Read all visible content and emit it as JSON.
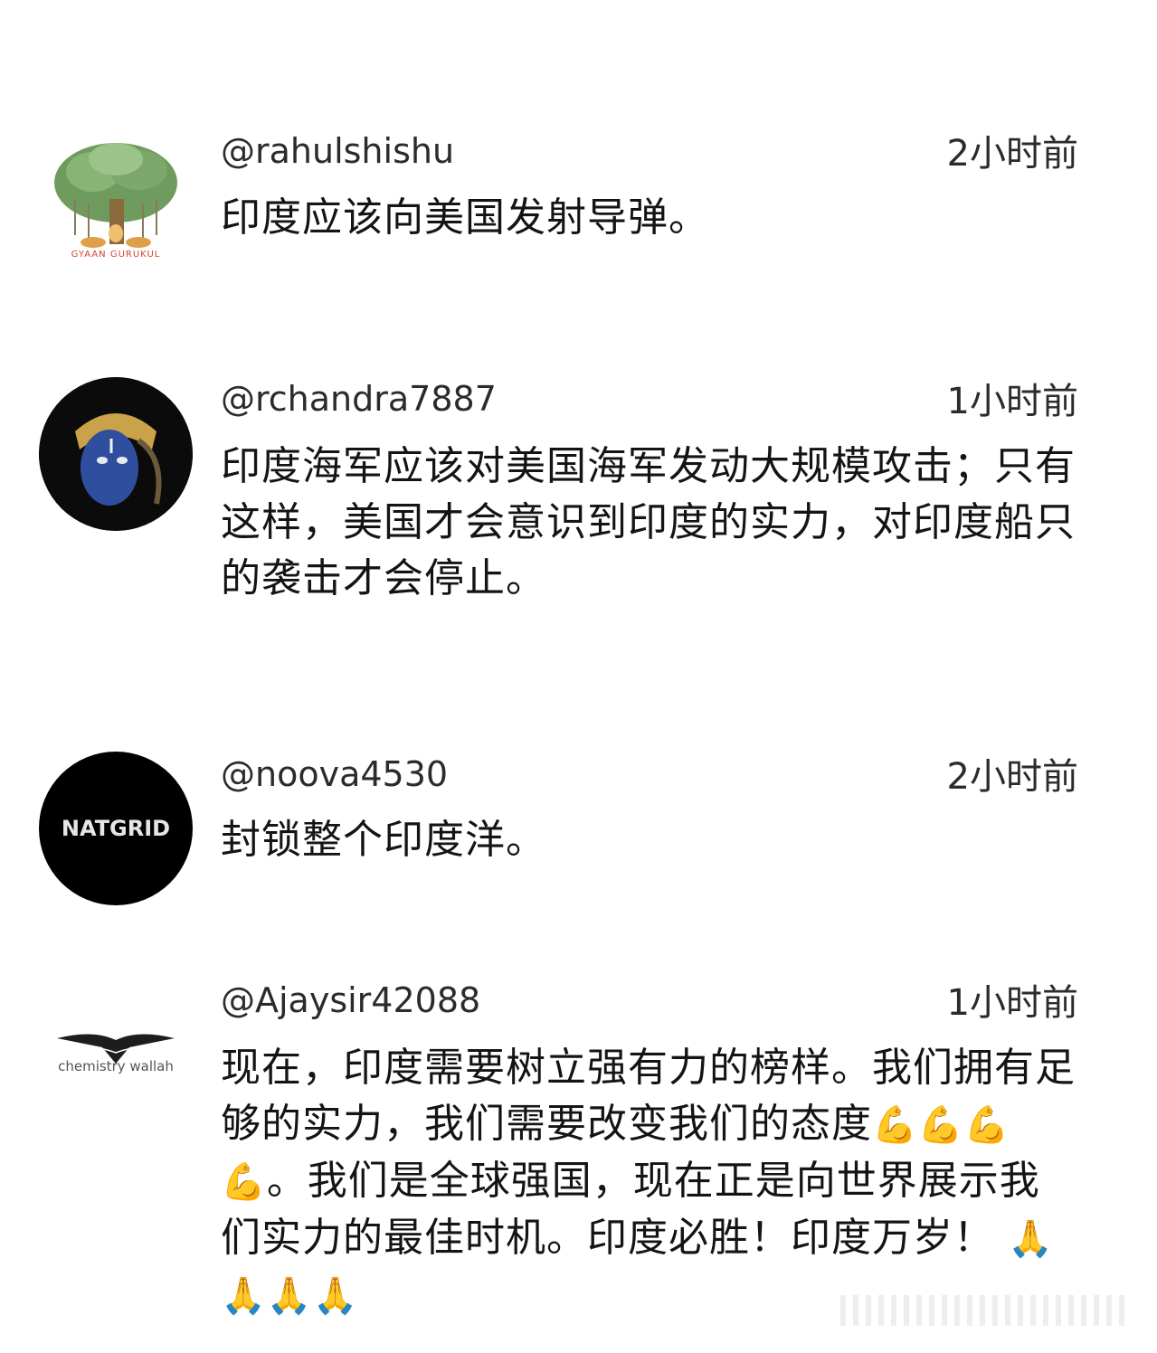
{
  "comments": [
    {
      "username": "@rahulshishu",
      "time": "2小时前",
      "text": "印度应该向美国发射导弹。",
      "avatar": "banyan-tree-logo",
      "avatar_caption": "GYAAN GURUKUL"
    },
    {
      "username": "@rchandra7887",
      "time": "1小时前",
      "text": "印度海军应该对美国海军发动大规模攻击；只有这样，美国才会意识到印度的实力，对印度船只的袭击才会停止。",
      "avatar": "krishna-portrait"
    },
    {
      "username": "@noova4530",
      "time": "2小时前",
      "text": "封锁整个印度洋。",
      "avatar": "natgrid-logo",
      "avatar_text": "NATGRID"
    },
    {
      "username": "@Ajaysir42088",
      "time": "1小时前",
      "text_part1": "现在，印度需要树立强有力的榜样。我们拥有足够的实力，我们需要改变我们的态度",
      "emoji_muscle": "💪",
      "text_part2": "。我们是全球强国，现在正是向世界展示我们实力的最佳时机。印度必胜！印度万岁！",
      "emoji_pray": "🙏",
      "avatar": "chemistry-wallah-logo",
      "avatar_text": "chemistry wallah"
    }
  ],
  "colors": {
    "text": "#141414",
    "meta": "#2b2b2b",
    "background": "#ffffff"
  }
}
